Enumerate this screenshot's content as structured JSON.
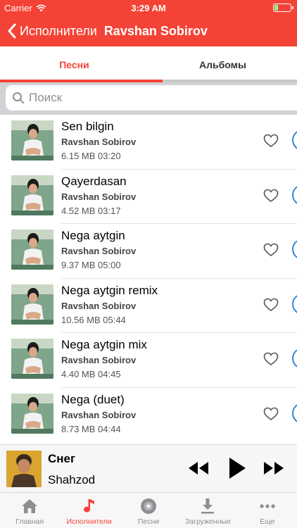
{
  "status_bar": {
    "carrier": "Carrier",
    "time": "3:29 AM"
  },
  "nav": {
    "back_label": "Исполнители",
    "title": "Ravshan Sobirov"
  },
  "tabs": [
    {
      "label": "Песни",
      "active": true
    },
    {
      "label": "Альбомы",
      "active": false
    }
  ],
  "search": {
    "placeholder": "Поиск"
  },
  "songs": [
    {
      "title": "Sen bilgin",
      "artist": "Ravshan Sobirov",
      "meta": "6.15 MB 03:20"
    },
    {
      "title": "Qayerdasan",
      "artist": "Ravshan Sobirov",
      "meta": "4.52 MB 03:17"
    },
    {
      "title": "Nega aytgin",
      "artist": "Ravshan Sobirov",
      "meta": "9.37 MB 05:00"
    },
    {
      "title": "Nega aytgin remix",
      "artist": "Ravshan Sobirov",
      "meta": "10.56 MB 05:44"
    },
    {
      "title": "Nega aytgin mix",
      "artist": "Ravshan Sobirov",
      "meta": "4.40 MB 04:45"
    },
    {
      "title": "Nega (duet)",
      "artist": "Ravshan Sobirov",
      "meta": "8.73 MB 04:44"
    }
  ],
  "player": {
    "track": "Снег",
    "artist": "Shahzod"
  },
  "tabbar": [
    {
      "label": "Главная",
      "icon": "home-icon",
      "active": false
    },
    {
      "label": "Исполнители",
      "icon": "music-note-icon",
      "active": true
    },
    {
      "label": "Песни",
      "icon": "disc-icon",
      "active": false
    },
    {
      "label": "Загруженные",
      "icon": "download-icon",
      "active": false
    },
    {
      "label": "Еще",
      "icon": "more-icon",
      "active": false
    }
  ],
  "colors": {
    "accent": "#f44336",
    "play_ring": "#2f86d6",
    "tab_inactive": "#8e8e93"
  }
}
